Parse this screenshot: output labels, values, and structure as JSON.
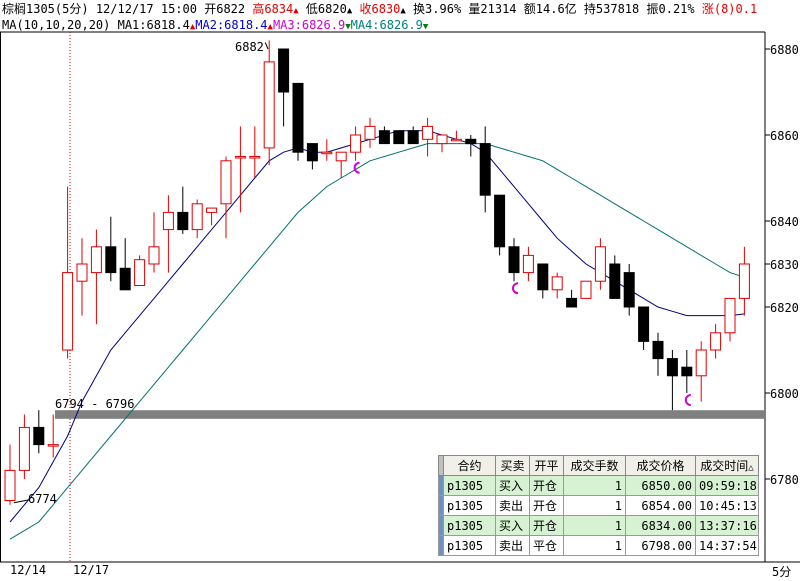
{
  "header": {
    "symbol": "棕榈1305",
    "period": "(5分)",
    "datetime": "12/12/17 15:00",
    "open_label": "开6822",
    "high_label": "高6834",
    "low_label": "低6820",
    "close_label": "收6830",
    "turnover_label": "换3.96%",
    "volume_label": "量21314",
    "amount_label": "额14.6亿",
    "position_label": "持537818",
    "amplitude_label": "振0.21%",
    "change_label": "涨(8)0.1"
  },
  "ma_line": {
    "params": "MA(10,10,20,20)",
    "ma1": "MA1:6818.4",
    "ma2": "MA2:6818.4",
    "ma3": "MA3:6826.9",
    "ma4": "MA4:6826.9"
  },
  "price_axis": [
    "6880",
    "6860",
    "6840",
    "6830",
    "6820",
    "6800",
    "6780"
  ],
  "date_axis": [
    "12/14",
    "12/17"
  ],
  "period_footer": "5分",
  "annotations": {
    "high_mark": "6882",
    "low_mark": "6774",
    "support_range": "6794 - 6796"
  },
  "trade_table": {
    "headers": [
      "合约",
      "买卖",
      "开平",
      "成交手数",
      "成交价格",
      "成交时间"
    ],
    "rows": [
      [
        "p1305",
        "买入",
        "开仓",
        "1",
        "6850.00",
        "09:59:18"
      ],
      [
        "p1305",
        "卖出",
        "开仓",
        "1",
        "6854.00",
        "10:45:13"
      ],
      [
        "p1305",
        "买入",
        "开仓",
        "1",
        "6834.00",
        "13:37:16"
      ],
      [
        "p1305",
        "卖出",
        "平仓",
        "1",
        "6798.00",
        "14:37:54"
      ]
    ]
  },
  "colors": {
    "up": "#e00000",
    "down": "#000000",
    "ma_fast": "#000080",
    "ma_slow": "#007070",
    "marker": "#d000d0",
    "support_band": "#808080"
  },
  "chart_data": {
    "type": "candlestick",
    "ylim": [
      6774,
      6886
    ],
    "candles": [
      [
        6775,
        6782,
        6774,
        6788
      ],
      [
        6782,
        6792,
        6780,
        6795
      ],
      [
        6792,
        6788,
        6786,
        6796
      ],
      [
        6788,
        6788,
        6785,
        6795
      ],
      [
        6810,
        6828,
        6808,
        6848
      ],
      [
        6826,
        6830,
        6818,
        6836
      ],
      [
        6828,
        6834,
        6816,
        6838
      ],
      [
        6834,
        6828,
        6826,
        6841
      ],
      [
        6829,
        6824,
        6824,
        6836
      ],
      [
        6825,
        6831,
        6825,
        6832
      ],
      [
        6830,
        6834,
        6828,
        6842
      ],
      [
        6838,
        6842,
        6828,
        6846
      ],
      [
        6842,
        6838,
        6837,
        6848
      ],
      [
        6838,
        6844,
        6836,
        6845
      ],
      [
        6842,
        6843,
        6839,
        6843
      ],
      [
        6844,
        6854,
        6836,
        6855
      ],
      [
        6855,
        6855,
        6842,
        6862
      ],
      [
        6855,
        6855,
        6850,
        6862
      ],
      [
        6857,
        6877,
        6853,
        6882
      ],
      [
        6880,
        6870,
        6862,
        6880
      ],
      [
        6872,
        6856,
        6854,
        6872
      ],
      [
        6858,
        6854,
        6852,
        6856
      ],
      [
        6856,
        6856,
        6854,
        6859
      ],
      [
        6854,
        6856,
        6850,
        6856
      ],
      [
        6856,
        6860,
        6854,
        6862
      ],
      [
        6859,
        6862,
        6857,
        6864
      ],
      [
        6861,
        6858,
        6858,
        6862
      ],
      [
        6861,
        6858,
        6858,
        6861
      ],
      [
        6861,
        6858,
        6858,
        6862
      ],
      [
        6859,
        6862,
        6855,
        6864
      ],
      [
        6858,
        6860,
        6856,
        6860
      ],
      [
        6859,
        6859,
        6859,
        6861
      ],
      [
        6859,
        6858,
        6855,
        6860
      ],
      [
        6858,
        6846,
        6842,
        6862
      ],
      [
        6846,
        6834,
        6832,
        6846
      ],
      [
        6834,
        6828,
        6826,
        6836
      ],
      [
        6828,
        6832,
        6826,
        6834
      ],
      [
        6830,
        6824,
        6822,
        6830
      ],
      [
        6824,
        6827,
        6822,
        6828
      ],
      [
        6822,
        6820,
        6820,
        6824
      ],
      [
        6822,
        6826,
        6824,
        6826
      ],
      [
        6826,
        6834,
        6824,
        6836
      ],
      [
        6830,
        6822,
        6822,
        6832
      ],
      [
        6828,
        6820,
        6818,
        6830
      ],
      [
        6820,
        6812,
        6810,
        6820
      ],
      [
        6812,
        6808,
        6804,
        6814
      ],
      [
        6808,
        6804,
        6796,
        6810
      ],
      [
        6806,
        6804,
        6800,
        6810
      ],
      [
        6804,
        6810,
        6798,
        6812
      ],
      [
        6810,
        6814,
        6808,
        6816
      ],
      [
        6814,
        6822,
        6812,
        6822
      ],
      [
        6822,
        6830,
        6818,
        6834
      ]
    ],
    "ma_fast": [
      6770,
      6774,
      6778,
      6784,
      6790,
      6798,
      6804,
      6810,
      6814,
      6818,
      6822,
      6826,
      6830,
      6834,
      6838,
      6842,
      6846,
      6850,
      6854,
      6856,
      6857,
      6856,
      6856,
      6857,
      6858,
      6859,
      6860,
      6861,
      6861,
      6861,
      6860,
      6859,
      6858,
      6856,
      6852,
      6848,
      6844,
      6840,
      6836,
      6833,
      6830,
      6828,
      6826,
      6824,
      6822,
      6820,
      6819,
      6818,
      6818,
      6818,
      6818,
      6818.4
    ],
    "ma_slow": [
      6766,
      6768,
      6770,
      6774,
      6778,
      6782,
      6786,
      6790,
      6794,
      6798,
      6802,
      6806,
      6810,
      6814,
      6818,
      6822,
      6826,
      6830,
      6834,
      6838,
      6842,
      6845,
      6848,
      6850,
      6852,
      6854,
      6855,
      6856,
      6857,
      6858,
      6858,
      6858,
      6858,
      6858,
      6857,
      6856,
      6855,
      6854,
      6852,
      6850,
      6848,
      6846,
      6844,
      6842,
      6840,
      6838,
      6836,
      6834,
      6832,
      6830,
      6828,
      6826.9
    ],
    "support_band": [
      6794,
      6796
    ],
    "trade_markers": [
      24,
      35,
      47
    ]
  }
}
